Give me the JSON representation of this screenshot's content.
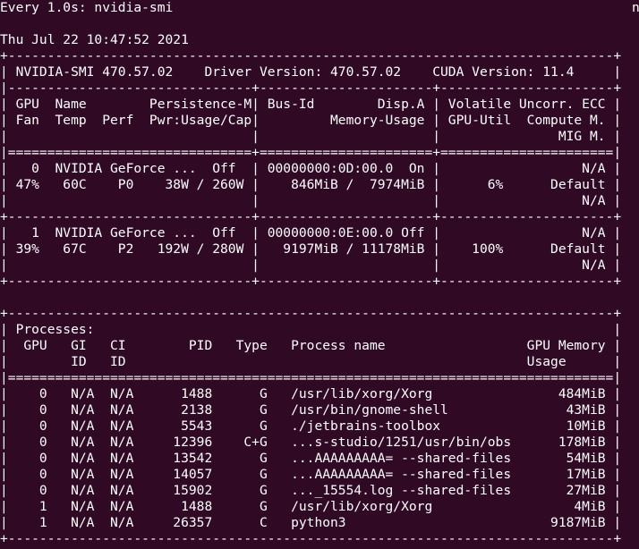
{
  "terminal": {
    "header_left": "Every 1.0s: nvidia-smi",
    "header_right": "n",
    "timestamp": "Thu Jul 22 10:47:52 2021"
  },
  "smi": {
    "border_top": "+-----------------------------------------------------------------------------+",
    "version_line": "| NVIDIA-SMI 470.57.02    Driver Version: 470.57.02    CUDA Version: 11.4     |",
    "sep_dash": "|-------------------------------+----------------------+----------------------+",
    "header_1": "| GPU  Name        Persistence-M| Bus-Id        Disp.A | Volatile Uncorr. ECC |",
    "header_2": "| Fan  Temp  Perf  Pwr:Usage/Cap|         Memory-Usage | GPU-Util  Compute M. |",
    "header_3": "|                               |                      |               MIG M. |",
    "sep_eq": "|===============================+======================+======================|",
    "gpus": [
      {
        "line_1": "|   0  NVIDIA GeForce ...  Off  | 00000000:0D:00.0  On |                  N/A |",
        "line_2": "| 47%   60C    P0    38W / 260W |    846MiB /  7974MiB |      6%      Default |",
        "line_3": "|                               |                      |                  N/A |",
        "separator": "+-------------------------------+----------------------+----------------------+"
      },
      {
        "line_1": "|   1  NVIDIA GeForce ...  Off  | 00000000:0E:00.0 Off |                  N/A |",
        "line_2": "| 39%   67C    P2   192W / 280W |   9197MiB / 11178MiB |    100%      Default |",
        "line_3": "|                               |                      |                  N/A |",
        "separator": "+-------------------------------+----------------------+----------------------+"
      }
    ]
  },
  "processes": {
    "border_top": "+-----------------------------------------------------------------------------+",
    "title": "| Processes:                                                                  |",
    "header_1": "|  GPU   GI   CI        PID   Type   Process name                  GPU Memory |",
    "header_2": "|        ID   ID                                                   Usage      |",
    "sep_eq": "|=============================================================================|",
    "rows": [
      "|    0   N/A  N/A      1488      G   /usr/lib/xorg/Xorg                484MiB |",
      "|    0   N/A  N/A      2138      G   /usr/bin/gnome-shell               43MiB |",
      "|    0   N/A  N/A      5543      G   ./jetbrains-toolbox                10MiB |",
      "|    0   N/A  N/A     12396    C+G   ...s-studio/1251/usr/bin/obs      178MiB |",
      "|    0   N/A  N/A     13542      G   ...AAAAAAAAA= --shared-files       54MiB |",
      "|    0   N/A  N/A     14057      G   ...AAAAAAAAA= --shared-files       17MiB |",
      "|    0   N/A  N/A     15902      G   ..._15554.log --shared-files       27MiB |",
      "|    1   N/A  N/A      1488      G   /usr/lib/xorg/Xorg                  4MiB |",
      "|    1   N/A  N/A     26357      C   python3                          9187MiB |"
    ],
    "border_bottom": "+-----------------------------------------------------------------------------+"
  }
}
